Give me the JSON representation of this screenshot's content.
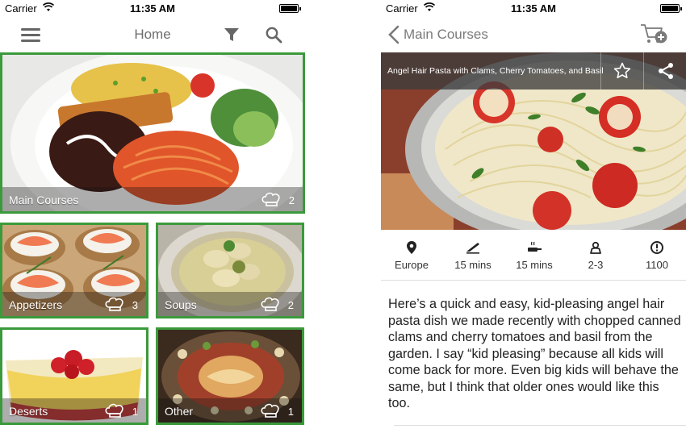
{
  "status_bar": {
    "carrier": "Carrier",
    "time": "11:35 AM"
  },
  "home": {
    "title": "Home",
    "categories": [
      {
        "label": "Main Courses",
        "count": "2"
      },
      {
        "label": "Appetizers",
        "count": "3"
      },
      {
        "label": "Soups",
        "count": "2"
      },
      {
        "label": "Deserts",
        "count": "1"
      },
      {
        "label": "Other",
        "count": "1"
      }
    ]
  },
  "detail": {
    "back_label": "Main Courses",
    "recipe_title": "Angel Hair Pasta with Clams, Cherry Tomatoes, and Basil",
    "meta": [
      {
        "icon": "location-icon",
        "value": "Europe"
      },
      {
        "icon": "prep-knife-icon",
        "value": "15 mins"
      },
      {
        "icon": "cooking-pan-icon",
        "value": "15 mins"
      },
      {
        "icon": "servings-icon",
        "value": "2-3"
      },
      {
        "icon": "calories-icon",
        "value": "1100"
      }
    ],
    "description": "Here’s a quick and easy, kid-pleasing angel hair pasta dish we made recently with chopped canned clams and cherry tomatoes and basil from the garden. I say “kid pleasing” because all kids will come back for more. Even big kids will behave the same, but I think that older ones would like this too."
  },
  "colors": {
    "tile_border": "#3b9a3b",
    "nav_text": "#6d6d6d"
  }
}
